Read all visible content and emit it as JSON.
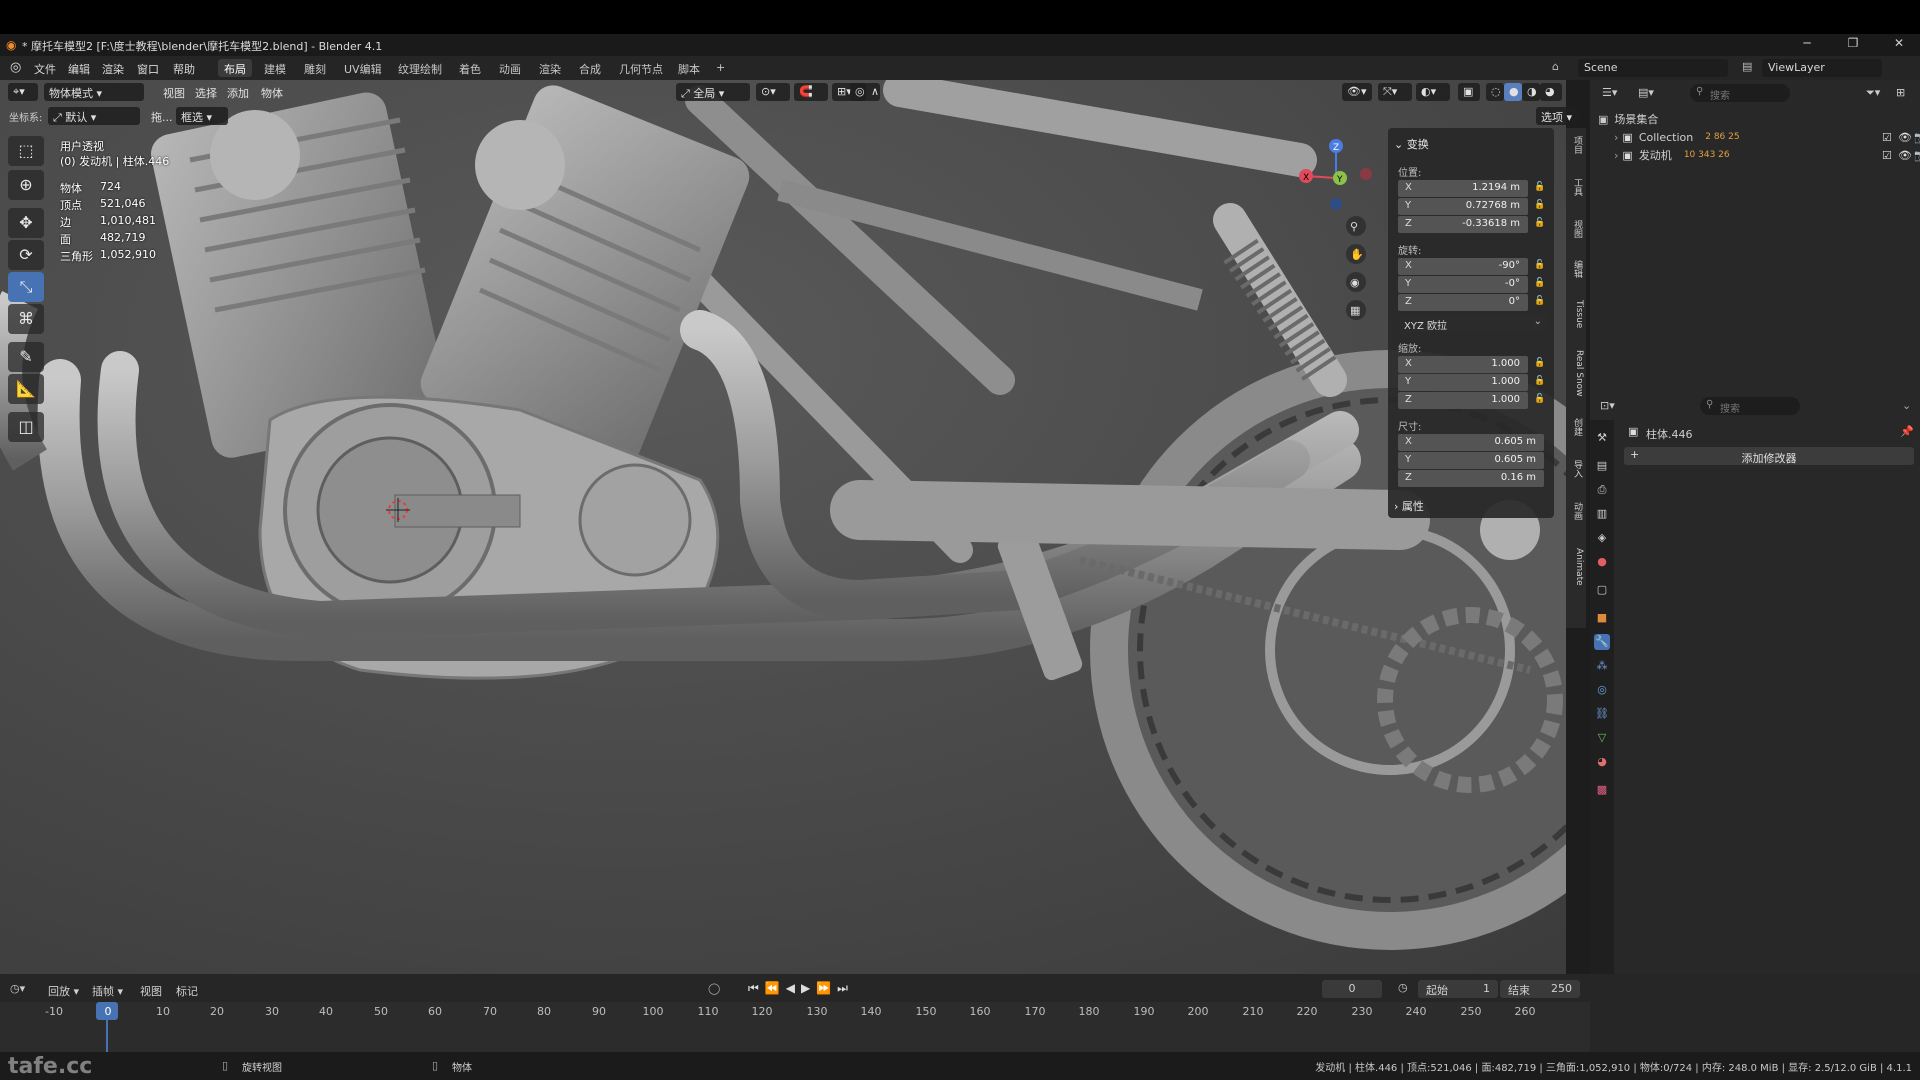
{
  "window": {
    "title": "* 摩托车模型2 [F:\\度士教程\\blender\\摩托车模型2.blend] - Blender 4.1",
    "min": "─",
    "max": "❐",
    "close": "✕"
  },
  "menubar": {
    "menus": [
      "文件",
      "编辑",
      "渲染",
      "窗口",
      "帮助"
    ],
    "workspaces": [
      "布局",
      "建模",
      "雕刻",
      "UV编辑",
      "纹理绘制",
      "着色",
      "动画",
      "渲染",
      "合成",
      "几何节点",
      "脚本"
    ],
    "active_workspace": "布局",
    "add_tab": "+",
    "scene": "Scene",
    "view_layer": "ViewLayer"
  },
  "viewport_header": {
    "mode": "物体模式",
    "menus": [
      "视图",
      "选择",
      "添加",
      "物体"
    ],
    "transform_orientation": "全局",
    "coord_label": "坐标系:",
    "coord_value": "默认",
    "drag_label": "拖...",
    "select_mode": "框选",
    "options": "选项"
  },
  "overlay": {
    "view_name": "用户透视",
    "object_path": "(0) 发动机 | 柱体.446",
    "stats": [
      {
        "label": "物体",
        "value": "724"
      },
      {
        "label": "顶点",
        "value": "521,046"
      },
      {
        "label": "边",
        "value": "1,010,481"
      },
      {
        "label": "面",
        "value": "482,719"
      },
      {
        "label": "三角形",
        "value": "1,052,910"
      }
    ]
  },
  "npanel": {
    "transform_header": "变换",
    "location_label": "位置:",
    "location": [
      {
        "axis": "X",
        "value": "1.2194 m"
      },
      {
        "axis": "Y",
        "value": "0.72768 m"
      },
      {
        "axis": "Z",
        "value": "-0.33618 m"
      }
    ],
    "rotation_label": "旋转:",
    "rotation": [
      {
        "axis": "X",
        "value": "-90°"
      },
      {
        "axis": "Y",
        "value": "-0°"
      },
      {
        "axis": "Z",
        "value": "0°"
      }
    ],
    "rotation_mode": "XYZ 欧拉",
    "scale_label": "缩放:",
    "scale": [
      {
        "axis": "X",
        "value": "1.000"
      },
      {
        "axis": "Y",
        "value": "1.000"
      },
      {
        "axis": "Z",
        "value": "1.000"
      }
    ],
    "dimensions_label": "尺寸:",
    "dimensions": [
      {
        "axis": "X",
        "value": "0.605 m"
      },
      {
        "axis": "Y",
        "value": "0.605 m"
      },
      {
        "axis": "Z",
        "value": "0.16 m"
      }
    ],
    "properties_header": "属性"
  },
  "side_tabs": [
    "项目",
    "工具",
    "视图",
    "编辑",
    "Tissue",
    "Real Snow",
    "创建",
    "导入",
    "动画",
    "Animate"
  ],
  "outliner": {
    "search_placeholder": "搜索",
    "scene_collection": "场景集合",
    "items": [
      {
        "name": "Collection",
        "badges": "2 86 25"
      },
      {
        "name": "发动机",
        "badges": "10 343 26"
      }
    ]
  },
  "properties": {
    "search_placeholder": "搜索",
    "object_name": "柱体.446",
    "add_modifier": "添加修改器"
  },
  "timeline": {
    "menus": [
      "回放",
      "插帧",
      "视图",
      "标记"
    ],
    "current_frame": "0",
    "start_label": "起始",
    "start": "1",
    "end_label": "结束",
    "end": "250",
    "ticks": [
      "-10",
      "0",
      "10",
      "20",
      "30",
      "40",
      "50",
      "60",
      "70",
      "80",
      "90",
      "100",
      "110",
      "120",
      "130",
      "140",
      "150",
      "160",
      "170",
      "180",
      "190",
      "200",
      "210",
      "220",
      "230",
      "240",
      "250",
      "260"
    ]
  },
  "statusbar": {
    "left_hint": "旋转视图",
    "mid_hint": "物体",
    "info": "发动机 | 柱体.446 | 顶点:521,046 | 面:482,719 | 三角面:1,052,910 | 物体:0/724 | 内存: 248.0 MiB | 显存: 2.5/12.0 GiB | 4.1.1"
  },
  "watermark": "tafe.cc",
  "colors": {
    "accent": "#4772b3",
    "viewport_bg": "#4a4a4a",
    "panel_bg": "#282828"
  }
}
